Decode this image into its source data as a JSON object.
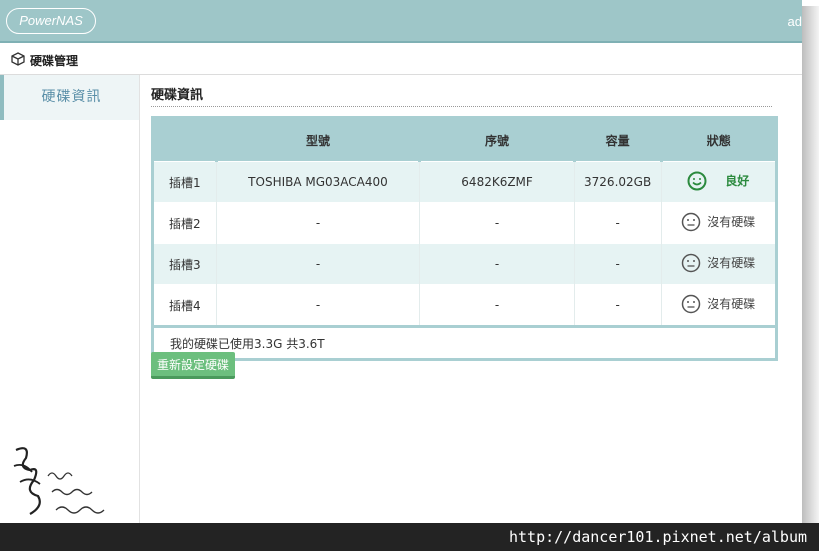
{
  "header": {
    "logo_text": "PowerNAS",
    "user_text": "ad"
  },
  "page": {
    "title": "硬碟管理",
    "icon": "cube-icon"
  },
  "sidebar": {
    "items": [
      {
        "label": "硬碟資訊",
        "active": true
      }
    ]
  },
  "section": {
    "title": "硬碟資訊"
  },
  "table": {
    "headers": [
      "",
      "型號",
      "序號",
      "容量",
      "狀態"
    ],
    "rows": [
      {
        "slot": "插槽1",
        "model": "TOSHIBA MG03ACA400",
        "serial": "6482K6ZMF",
        "capacity": "3726.02GB",
        "status": "良好",
        "status_icon": "smile-icon"
      },
      {
        "slot": "插槽2",
        "model": "-",
        "serial": "-",
        "capacity": "-",
        "status": "沒有硬碟",
        "status_icon": "neutral-face-icon"
      },
      {
        "slot": "插槽3",
        "model": "-",
        "serial": "-",
        "capacity": "-",
        "status": "沒有硬碟",
        "status_icon": "neutral-face-icon"
      },
      {
        "slot": "插槽4",
        "model": "-",
        "serial": "-",
        "capacity": "-",
        "status": "沒有硬碟",
        "status_icon": "neutral-face-icon"
      }
    ],
    "summary": "我的硬碟已使用3.3G 共3.6T"
  },
  "actions": {
    "reset_label": "重新設定硬碟"
  },
  "footer": {
    "url": "http://dancer101.pixnet.net/album"
  },
  "colors": {
    "header_bg": "#9ec6c8",
    "table_header": "#a9cfd2",
    "good": "#2b8a3e",
    "button": "#6cbf7e"
  }
}
